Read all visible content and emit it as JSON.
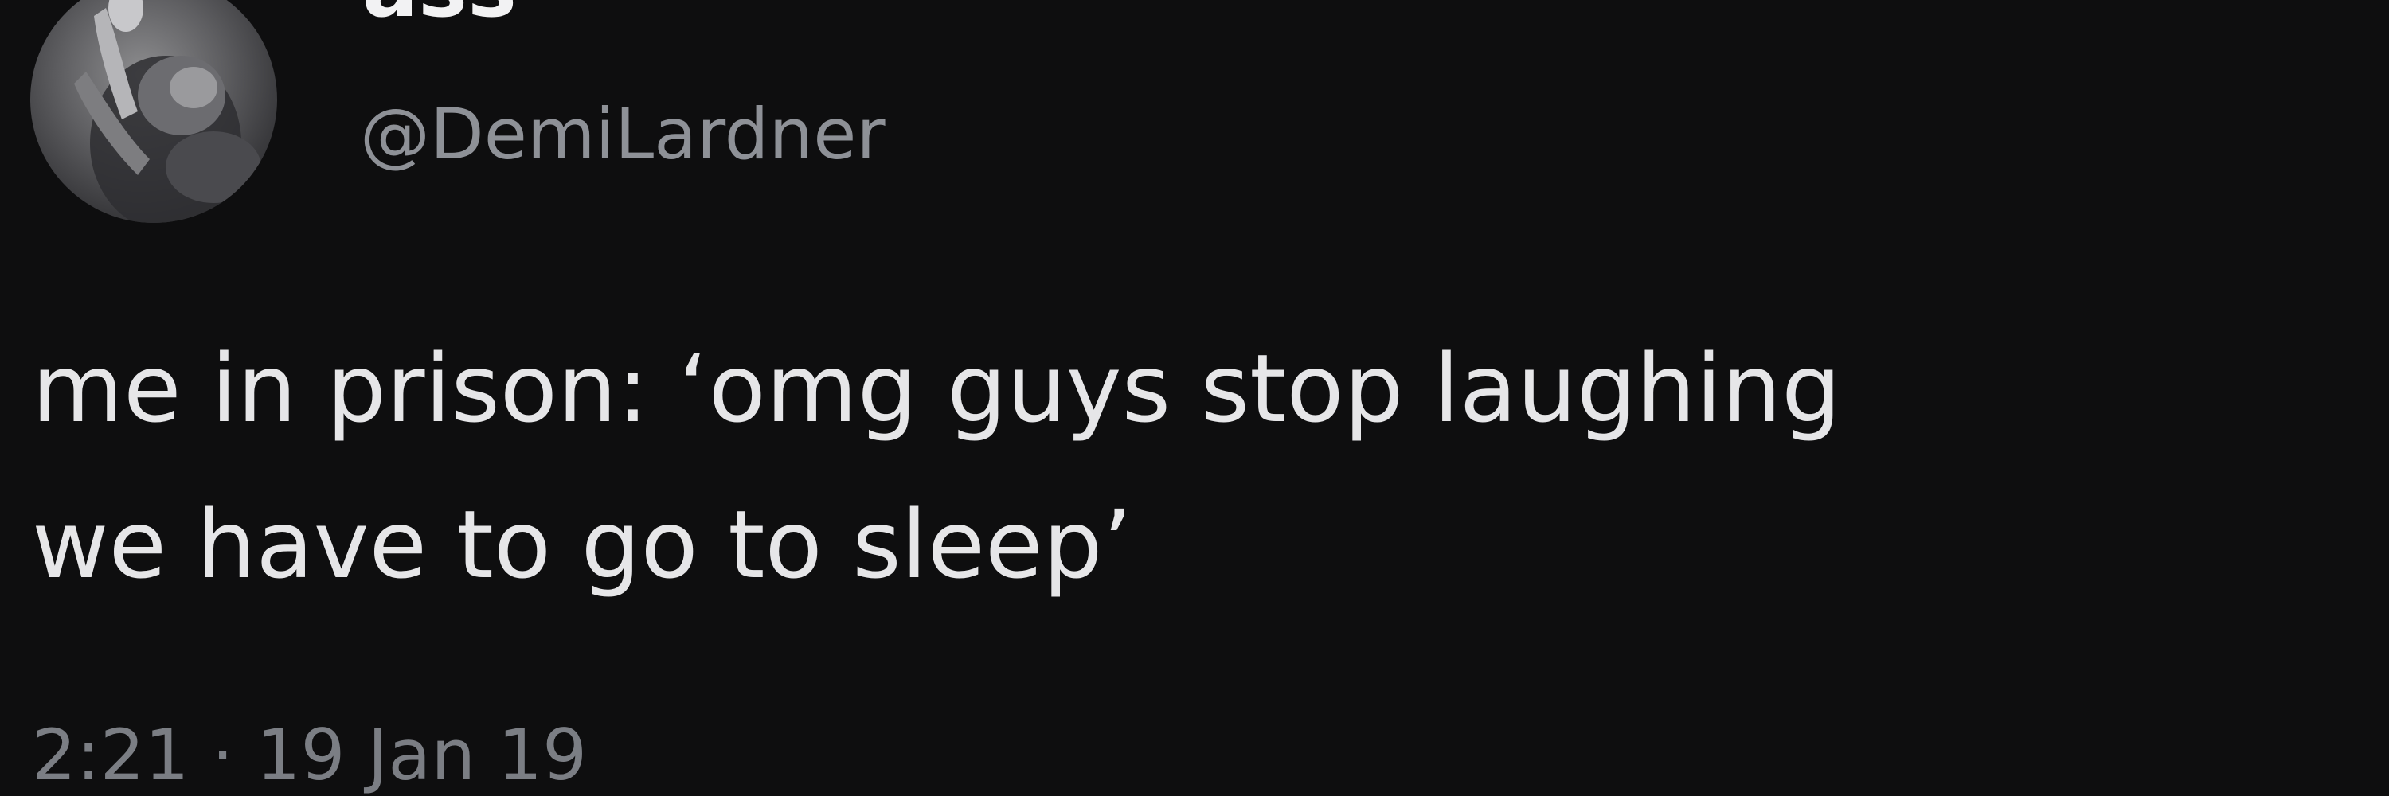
{
  "tweet": {
    "author": {
      "display_name": "ass",
      "handle": "@DemiLardner"
    },
    "text_lines": [
      "me in prison: ‘omg guys stop laughing",
      "we have to go to sleep’"
    ],
    "timestamp": "2:21 · 19 Jan 19"
  },
  "colors": {
    "background": "#0e0e0f",
    "text": "#e6e6e8",
    "handle": "#8e9197",
    "timestamp": "#7b7e84"
  },
  "icons": {
    "avatar": "profile-photo-avatar"
  }
}
